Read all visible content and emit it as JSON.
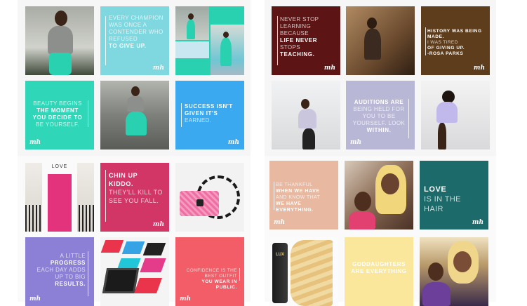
{
  "tiles": {
    "t1": {
      "label": ""
    },
    "t2": {
      "text": "EVERY CHAMPION WAS ONCE A CONTENDER WHO REFUSED",
      "bold": "TO GIVE UP.",
      "logo": "mh"
    },
    "t3": {
      "label": ""
    },
    "t4": {
      "text1": "BEAUTY BEGINS",
      "bold": "THE MOMENT YOU DECIDE TO",
      "text2": "BE YOURSELF.",
      "logo": "mh"
    },
    "t5": {
      "label": ""
    },
    "t6": {
      "bold": "SUCCESS ISN'T GIVEN IT'S",
      "text": "EARNED.",
      "logo": "mh"
    },
    "t7": {
      "text1": "NEVER STOP LEARNING BECAUSE",
      "bold": "LIFE NEVER",
      "text2": "STOPS",
      "bold2": "TEACHING.",
      "logo": "mh"
    },
    "t8": {
      "label": ""
    },
    "t9": {
      "text1": "HISTORY WAS BEING MADE.",
      "text2": "I WAS TIRED",
      "text3": "OF GIVING UP.",
      "text4": "-ROSA PARKS",
      "logo": "mh"
    },
    "t10": {
      "label": ""
    },
    "t11": {
      "bold": "AUDITIONS ARE",
      "text": "BEING HELD FOR YOU TO BE YOURSELF. LOOK",
      "bold2": "WITHIN.",
      "logo": "mh"
    },
    "t12": {
      "label": ""
    },
    "t13": {
      "sign": "LOVE"
    },
    "t14": {
      "bold": "CHIN UP KIDDO.",
      "text": "THEY'LL KILL TO SEE YOU FALL.",
      "logo": "mh"
    },
    "t15": {
      "label": ""
    },
    "t16": {
      "text1": "A LITTLE",
      "bold": "PROGRESS",
      "text2": "EACH DAY ADDS UP TO BIG",
      "bold2": "RESULTS.",
      "logo": "mh"
    },
    "t17": {
      "label": ""
    },
    "t18": {
      "text": "CONFIDENCE IS THE BEST OUTFIT",
      "bold": "YOU WEAR IN PUBLIC.",
      "logo": "mh"
    },
    "t19": {
      "text1": "BE THANKFUL",
      "bold": "WHEN WE HAVE",
      "text2": "AND KNOW THAT",
      "bold2": "WE HAVE EVERYTHING.",
      "logo": "mh"
    },
    "t20": {
      "label": ""
    },
    "t21": {
      "bold": "LOVE",
      "text": "IS IN THE HAIR",
      "logo": "mh"
    },
    "t22": {
      "brand": "LUX"
    },
    "t23": {
      "bold": "GODDAUGHTERS ARE EVERYTHING"
    },
    "t24": {
      "label": ""
    }
  },
  "colors": {
    "teal": "#2fd6b8",
    "sky": "#7fd8df",
    "blue": "#3aa9f0",
    "maroon": "#5c1414",
    "brown": "#5e3d1c",
    "lavender": "#b9b7d6",
    "pink": "#d13667",
    "purple": "#8b7fd6",
    "coral": "#f25d68",
    "peach": "#e8b8a0",
    "pine": "#1c6b6a",
    "yellow": "#fae79b"
  }
}
